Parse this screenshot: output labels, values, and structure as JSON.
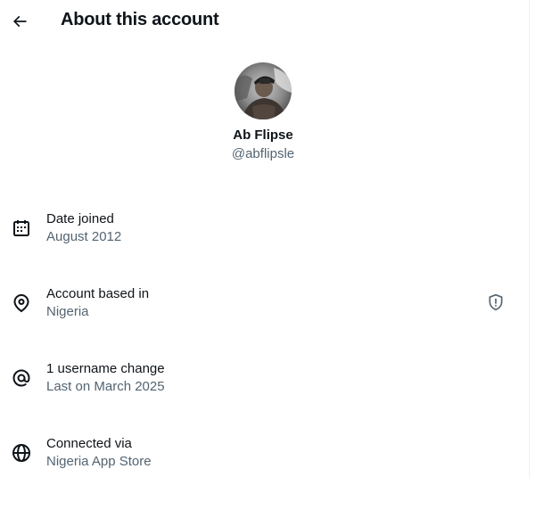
{
  "header": {
    "title": "About this account",
    "back_icon": "arrow-left-icon"
  },
  "profile": {
    "name": "Ab Flipse",
    "handle": "@abflipsle"
  },
  "details": [
    {
      "icon": "calendar-icon",
      "label": "Date joined",
      "value": "August 2012"
    },
    {
      "icon": "location-pin-icon",
      "label": "Account based in",
      "value": "Nigeria",
      "extra_icon": "shield-alert-icon"
    },
    {
      "icon": "at-sign-icon",
      "label": "1 username change",
      "value": "Last on March 2025"
    },
    {
      "icon": "globe-icon",
      "label": "Connected via",
      "value": "Nigeria App Store"
    }
  ],
  "colors": {
    "text_primary": "#0f1419",
    "text_secondary": "#536471",
    "background": "#ffffff"
  }
}
